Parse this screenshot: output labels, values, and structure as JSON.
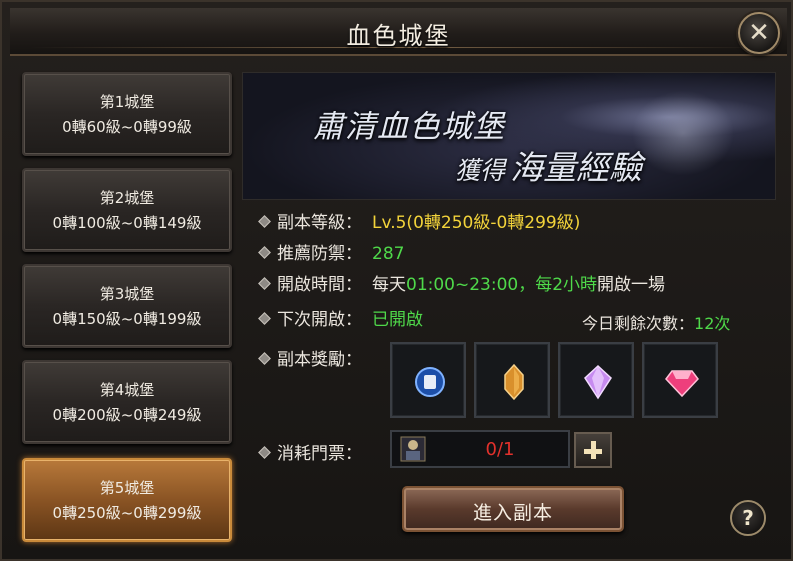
{
  "window": {
    "title": "血色城堡",
    "close_icon": "close-icon"
  },
  "castles": [
    {
      "name": "第1城堡",
      "range": "0轉60級~0轉99級",
      "active": false
    },
    {
      "name": "第2城堡",
      "range": "0轉100級~0轉149級",
      "active": false
    },
    {
      "name": "第3城堡",
      "range": "0轉150級~0轉199級",
      "active": false
    },
    {
      "name": "第4城堡",
      "range": "0轉200級~0轉249級",
      "active": false
    },
    {
      "name": "第5城堡",
      "range": "0轉250級~0轉299級",
      "active": true
    }
  ],
  "banner": {
    "line1": "肅清血色城堡",
    "line2_prefix": "獲得",
    "line2_emphasis": "海量經驗"
  },
  "info": {
    "level": {
      "label": "副本等級",
      "value": "Lv.5(0轉250級-0轉299級)"
    },
    "defense": {
      "label": "推薦防禦",
      "value": "287"
    },
    "open_time": {
      "label": "開啟時間",
      "prefix": "每天",
      "time": "01:00~23:00，每2小時",
      "suffix": "開啟一場"
    },
    "next_open": {
      "label": "下次開啟",
      "value": "已開啟"
    },
    "remaining": {
      "label": "今日剩餘次數",
      "value": "12次"
    },
    "rewards": {
      "label": "副本獎勵",
      "items": [
        "blue-orb-icon",
        "amber-crystal-icon",
        "purple-gem-icon",
        "pink-diamond-icon"
      ]
    },
    "ticket": {
      "label": "消耗門票",
      "count": "0/1"
    }
  },
  "buttons": {
    "enter": "進入副本",
    "help": "?",
    "plus": "+"
  },
  "colors": {
    "yellow": "#f2d33a",
    "green": "#4fd94a",
    "red": "#e2312c",
    "active_tab": "#b8793a"
  },
  "separator": "："
}
